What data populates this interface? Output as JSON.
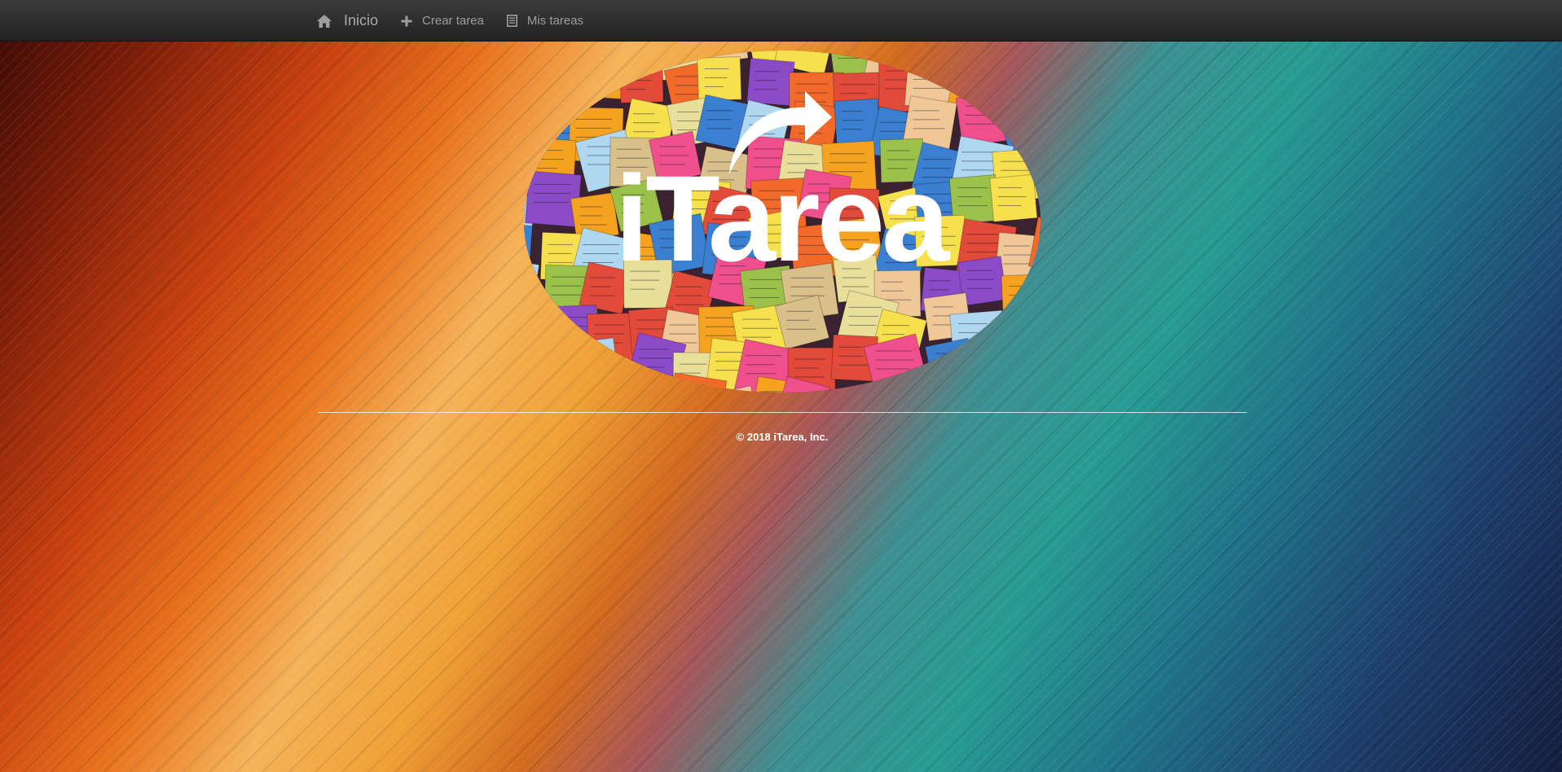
{
  "nav": {
    "brand_label": "Inicio",
    "brand_icon": "home-icon",
    "items": [
      {
        "label": "Crear tarea",
        "icon": "plus-icon"
      },
      {
        "label": "Mis tareas",
        "icon": "list-icon"
      }
    ]
  },
  "hero": {
    "logo_text": "iTarea",
    "logo_alt": "iTarea logo with sticky notes"
  },
  "footer": {
    "copyright": "© 2018 iTarea, Inc."
  },
  "colors": {
    "navbar": "#222222",
    "nav_text": "#9d9d9d",
    "footer_text": "#ffffff"
  }
}
